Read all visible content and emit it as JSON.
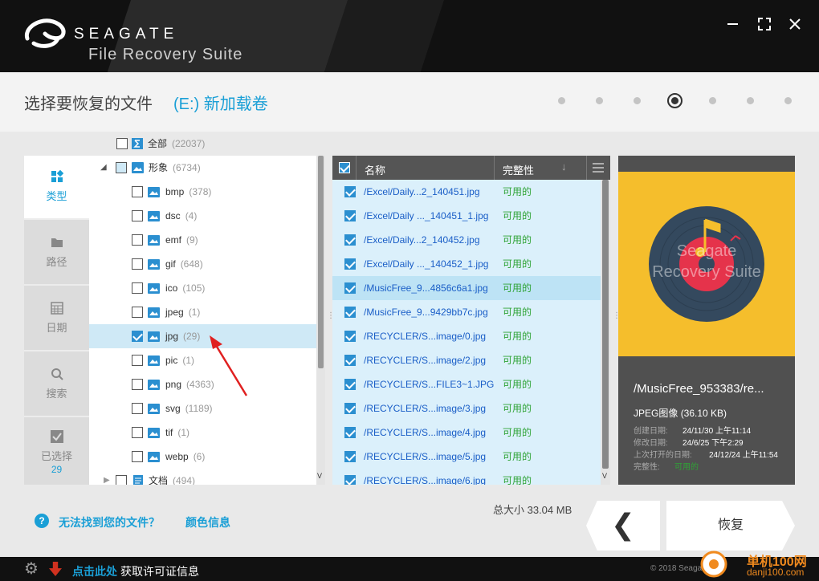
{
  "header": {
    "brand": "SEAGATE",
    "suite": "File Recovery Suite",
    "window_buttons": [
      "minimize",
      "maximize",
      "close"
    ]
  },
  "title": {
    "text": "选择要恢复的文件",
    "drive": "(E:) 新加载卷",
    "step_current": 4,
    "step_total": 7
  },
  "nav": {
    "tabs": [
      {
        "label": "类型",
        "icon": "grid-icon",
        "active": true
      },
      {
        "label": "路径",
        "icon": "folder-icon",
        "active": false
      },
      {
        "label": "日期",
        "icon": "calendar-icon",
        "active": false
      },
      {
        "label": "搜索",
        "icon": "search-icon",
        "active": false
      },
      {
        "label": "已选择",
        "icon": "check-icon",
        "active": false,
        "count": "29"
      }
    ]
  },
  "tree": {
    "all": {
      "label": "全部",
      "count": "(22037)"
    },
    "images": {
      "label": "形象",
      "count": "(6734)"
    },
    "items": [
      {
        "label": "bmp",
        "count": "(378)",
        "checked": false
      },
      {
        "label": "dsc",
        "count": "(4)",
        "checked": false
      },
      {
        "label": "emf",
        "count": "(9)",
        "checked": false
      },
      {
        "label": "gif",
        "count": "(648)",
        "checked": false
      },
      {
        "label": "ico",
        "count": "(105)",
        "checked": false
      },
      {
        "label": "jpeg",
        "count": "(1)",
        "checked": false
      },
      {
        "label": "jpg",
        "count": "(29)",
        "checked": true
      },
      {
        "label": "pic",
        "count": "(1)",
        "checked": false
      },
      {
        "label": "png",
        "count": "(4363)",
        "checked": false
      },
      {
        "label": "svg",
        "count": "(1189)",
        "checked": false
      },
      {
        "label": "tif",
        "count": "(1)",
        "checked": false
      },
      {
        "label": "webp",
        "count": "(6)",
        "checked": false
      }
    ],
    "docs": {
      "label": "文档",
      "count": "(494)"
    }
  },
  "list": {
    "col_name": "名称",
    "col_integrity": "完整性",
    "rows": [
      {
        "name": "/Excel/Daily...2_140451.jpg",
        "status": "可用的",
        "highlight": false
      },
      {
        "name": "/Excel/Daily ..._140451_1.jpg",
        "status": "可用的",
        "highlight": false
      },
      {
        "name": "/Excel/Daily...2_140452.jpg",
        "status": "可用的",
        "highlight": false
      },
      {
        "name": "/Excel/Daily ..._140452_1.jpg",
        "status": "可用的",
        "highlight": false
      },
      {
        "name": "/MusicFree_9...4856c6a1.jpg",
        "status": "可用的",
        "highlight": true
      },
      {
        "name": "/MusicFree_9...9429bb7c.jpg",
        "status": "可用的",
        "highlight": false
      },
      {
        "name": "/RECYCLER/S...image/0.jpg",
        "status": "可用的",
        "highlight": false
      },
      {
        "name": "/RECYCLER/S...image/2.jpg",
        "status": "可用的",
        "highlight": false
      },
      {
        "name": "/RECYCLER/S...FILE3~1.JPG",
        "status": "可用的",
        "highlight": false
      },
      {
        "name": "/RECYCLER/S...image/3.jpg",
        "status": "可用的",
        "highlight": false
      },
      {
        "name": "/RECYCLER/S...image/4.jpg",
        "status": "可用的",
        "highlight": false
      },
      {
        "name": "/RECYCLER/S...image/5.jpg",
        "status": "可用的",
        "highlight": false
      },
      {
        "name": "/RECYCLER/S...image/6.jpg",
        "status": "可用的",
        "highlight": false
      }
    ]
  },
  "preview": {
    "watermark1": "Seagate",
    "watermark2": "Recovery Suite",
    "name": "/MusicFree_953383/re...",
    "type": "JPEG图像",
    "size": "(36.10 KB)",
    "created_label": "创建日期:",
    "created": "24/11/30 上午11:14",
    "modified_label": "修改日期:",
    "modified": "24/6/25 下午2:29",
    "opened_label": "上次打开的日期:",
    "opened": "24/12/24 上午11:54",
    "integrity_label": "完整性:",
    "integrity": "可用的"
  },
  "bottom": {
    "help_icon": "?",
    "cant_find": "无法找到您的文件？",
    "color_info": "颜色信息",
    "total": "总大小 33.04 MB",
    "back": "❮",
    "recover": "恢复"
  },
  "footer": {
    "click_here": "点击此处",
    "license": "获取许可证信息",
    "copyright": "© 2018 Seagate"
  },
  "watermark": {
    "line1": "单机100网",
    "line2": "danji100.com"
  },
  "colors": {
    "accent": "#1a9fd6",
    "available": "#2fa336",
    "link": "#1a5ec7",
    "preview_bg": "#f5be2c"
  }
}
